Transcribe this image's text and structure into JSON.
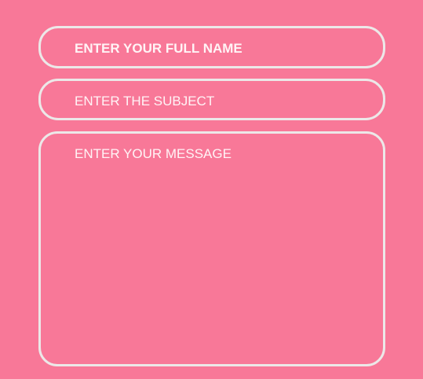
{
  "form": {
    "name_field": {
      "placeholder": "ENTER YOUR FULL NAME"
    },
    "subject_field": {
      "placeholder": "ENTER THE SUBJECT"
    },
    "message_field": {
      "placeholder": "ENTER YOUR MESSAGE"
    }
  },
  "colors": {
    "background": "#f87898",
    "field_border": "#ece8e8",
    "placeholder_text": "#fff4f6"
  }
}
